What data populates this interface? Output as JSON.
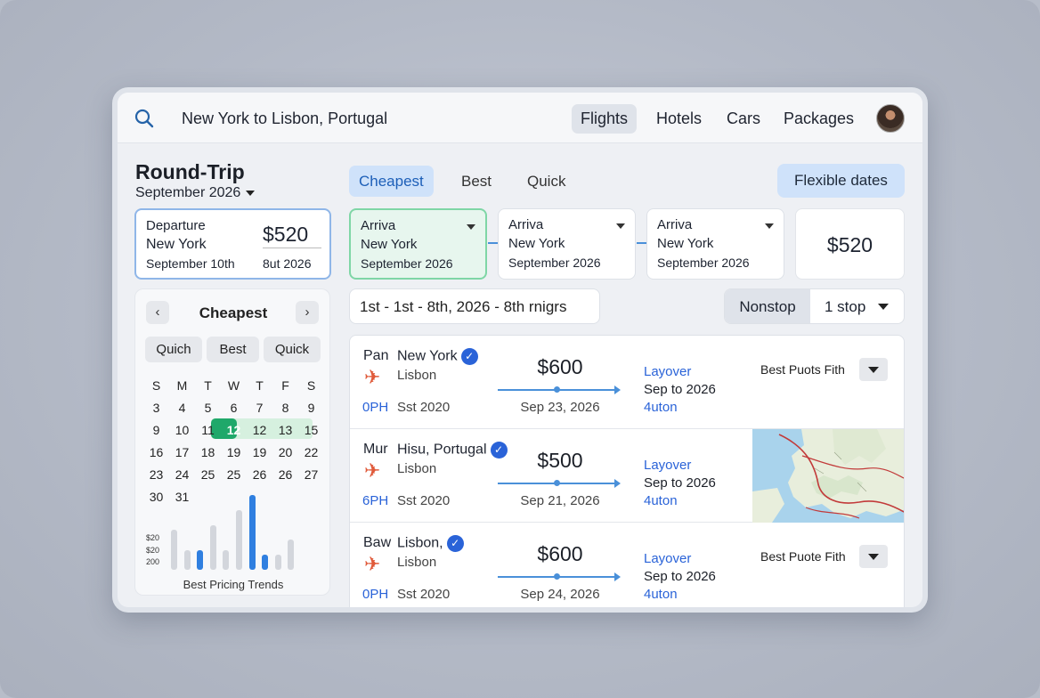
{
  "search": {
    "query": "New York to Lisbon, Portugal"
  },
  "nav": {
    "tabs": [
      "Flights",
      "Hotels",
      "Cars",
      "Packages"
    ],
    "active": "Flights"
  },
  "trip": {
    "title": "Round-Trip",
    "month": "September 2026"
  },
  "departure": {
    "label": "Departure",
    "city": "New York",
    "date": "September 10th",
    "price": "$520",
    "sub": "8ut 2026"
  },
  "calendar": {
    "title": "Cheapest",
    "filters": [
      "Quich",
      "Best",
      "Quick"
    ],
    "weekdays": [
      "S",
      "M",
      "T",
      "W",
      "T",
      "F",
      "S"
    ],
    "weeks": [
      [
        "3",
        "4",
        "5",
        "6",
        "7",
        "8",
        "9"
      ],
      [
        "9",
        "10",
        "11",
        "12",
        "12",
        "13",
        "15"
      ],
      [
        "16",
        "17",
        "18",
        "19",
        "19",
        "20",
        "22"
      ],
      [
        "23",
        "24",
        "25",
        "25",
        "26",
        "26",
        "27"
      ],
      [
        "30",
        "31",
        "",
        "",
        "",
        "",
        ""
      ]
    ],
    "selected_day": "12",
    "price_labels": [
      "$20",
      "$20",
      "200"
    ],
    "trend_label": "Best Pricing Trends",
    "trend_levels": [
      0.4,
      0.2,
      0.2,
      0.45,
      0.2,
      0.6,
      0.75,
      0.15,
      0.15,
      0.3
    ],
    "trend_highlight": [
      false,
      false,
      true,
      false,
      false,
      false,
      true,
      true,
      false,
      false
    ]
  },
  "sort_tabs": {
    "items": [
      "Cheapest",
      "Best",
      "Quick"
    ],
    "active": "Cheapest"
  },
  "flexible_dates": "Flexible dates",
  "segments": [
    {
      "label": "Arriva",
      "city": "New York",
      "date": "September 2026"
    },
    {
      "label": "Arriva",
      "city": "New York",
      "date": "September 2026"
    },
    {
      "label": "Arriva",
      "city": "New York",
      "date": "September 2026"
    }
  ],
  "total_price": "$520",
  "date_range": "1st - 1st -  8th, 2026  -  8th rnigrs",
  "stops": {
    "nonstop": "Nonstop",
    "one_stop": "1 stop"
  },
  "results": [
    {
      "code": "Pan",
      "dest": "New York",
      "origin": "Lisbon",
      "time": "0PH",
      "status": "Sst 2020",
      "price": "$600",
      "date": "Sep 23, 2026",
      "layover": "Layover",
      "layover_date": "Sep to 2026",
      "layover_sub": "4uton",
      "best": "Best Puots Fith"
    },
    {
      "code": "Mur",
      "dest": "Hisu, Portugal",
      "origin": "Lisbon",
      "time": "6PH",
      "status": "Sst 2020",
      "price": "$500",
      "date": "Sep 21, 2026",
      "layover": "Layover",
      "layover_date": "Sep to 2026",
      "layover_sub": "4uton",
      "best": ""
    },
    {
      "code": "Baw",
      "dest": "Lisbon,",
      "origin": "Lisbon",
      "time": "0PH",
      "status": "Sst 2020",
      "price": "$600",
      "date": "Sep 24, 2026",
      "layover": "Layover",
      "layover_date": "Sep to 2026",
      "layover_sub": "4uton",
      "best": "Best Puote Fith"
    }
  ],
  "colors": {
    "accent": "#2a63d8",
    "selected_day": "#1fa86a",
    "tab_active_bg": "#cfe2fa",
    "plane": "#e05a3a"
  }
}
